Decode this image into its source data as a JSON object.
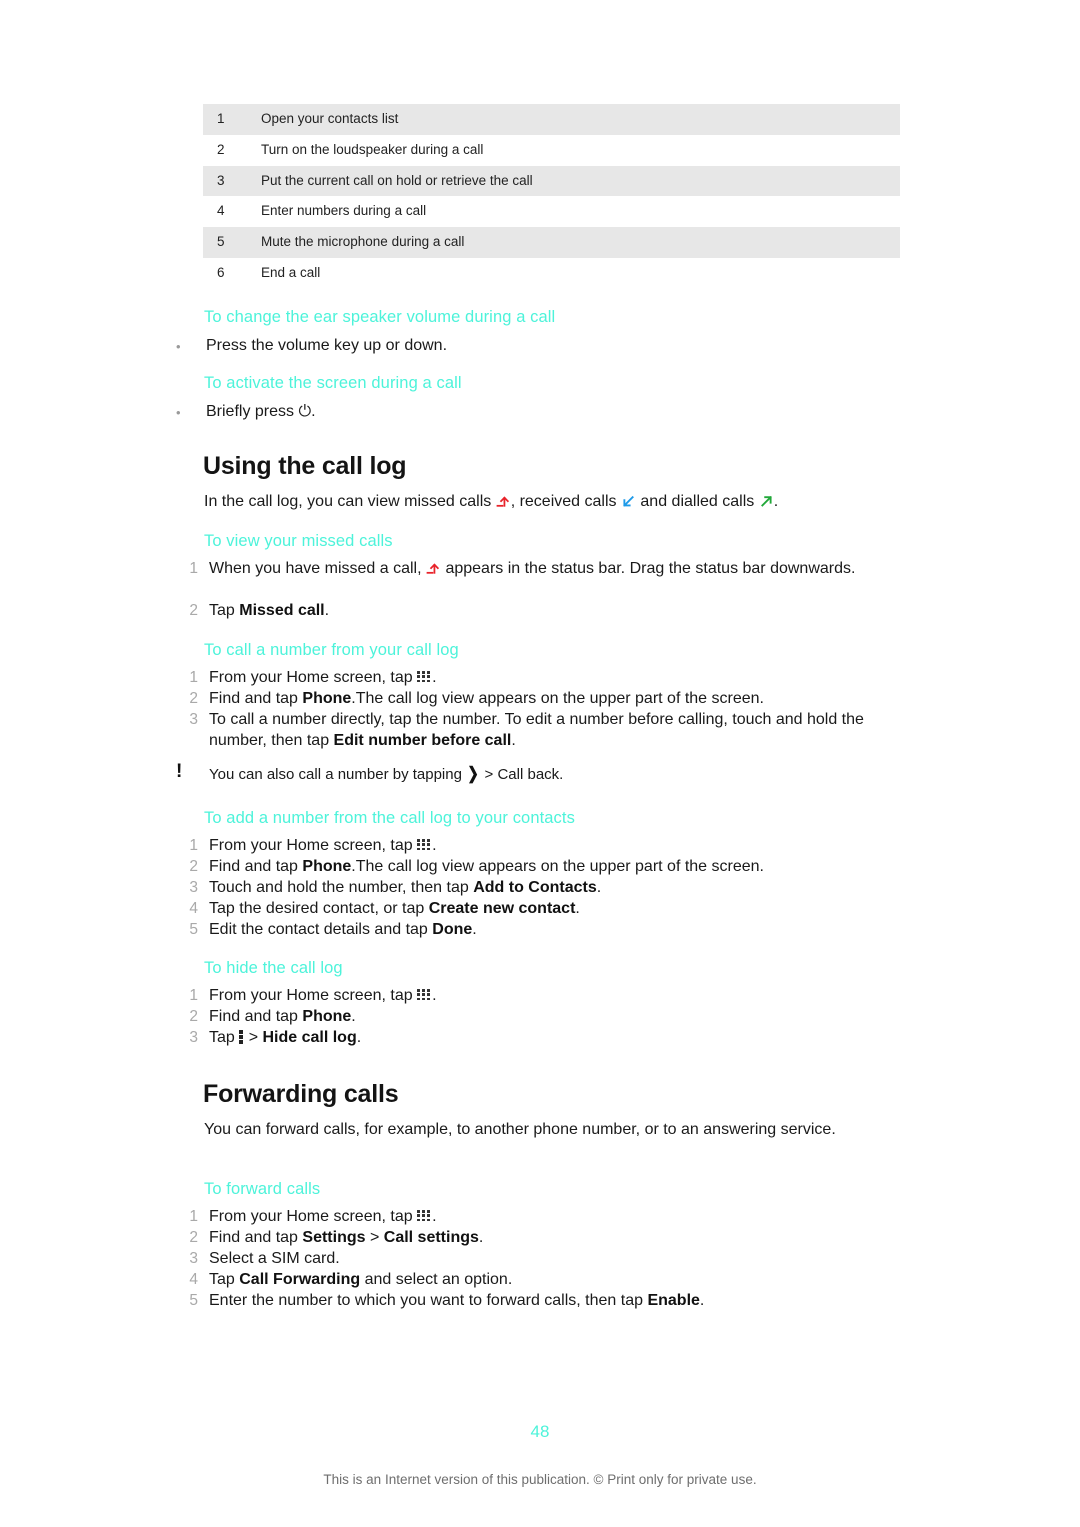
{
  "document": {
    "page_number": "48",
    "footer_note": "This is an Internet version of this publication. © Print only for private use.",
    "accent_color": "#4df3da",
    "missed_call_color": "#e8232a",
    "received_call_color": "#1e9ae8",
    "dialled_call_color": "#22a83a"
  },
  "legend_table": {
    "rows": [
      {
        "num": "1",
        "desc": "Open your contacts list"
      },
      {
        "num": "2",
        "desc": "Turn on the loudspeaker during a call"
      },
      {
        "num": "3",
        "desc": "Put the current call on hold or retrieve the call"
      },
      {
        "num": "4",
        "desc": "Enter numbers during a call"
      },
      {
        "num": "5",
        "desc": "Mute the microphone during a call"
      },
      {
        "num": "6",
        "desc": "End a call"
      }
    ]
  },
  "sections": {
    "ear_speaker": {
      "heading": "To change the ear speaker volume during a call",
      "bullet": "Press the volume key up or down."
    },
    "activate_screen": {
      "heading": "To activate the screen during a call",
      "bullet_prefix": "Briefly press ",
      "bullet_suffix": ".",
      "icon_name": "power-button-icon"
    },
    "using_call_log": {
      "title": "Using the call log",
      "intro_part1": "In the call log, you can view missed calls ",
      "intro_part2": ", received calls ",
      "intro_part3": " and dialled calls ",
      "intro_part4": "."
    },
    "view_missed": {
      "heading": "To view your missed calls",
      "step1_part1": "When you have missed a call, ",
      "step1_part2": " appears in the status bar. Drag the status bar downwards.",
      "step2_part1": "Tap ",
      "step2_bold": "Missed call",
      "step2_part2": "."
    },
    "call_number": {
      "heading": "To call a number from your call log",
      "step1_part1": "From your Home screen, tap ",
      "step1_part2": ".",
      "step2_part1": "Find and tap ",
      "step2_bold": "Phone",
      "step2_part2": ".The call log view appears on the upper part of the screen.",
      "step3_part1": "To call a number directly, tap the number. To edit a number before calling, touch and hold the number, then tap ",
      "step3_bold": "Edit number before call",
      "step3_part2": ".",
      "tip_part1": "You can also call a number by tapping ",
      "tip_part2": " > Call back."
    },
    "add_number": {
      "heading": "To add a number from the call log to your contacts",
      "step1_part1": "From your Home screen, tap ",
      "step1_part2": ".",
      "step2_part1": "Find and tap ",
      "step2_bold": "Phone",
      "step2_part2": ".The call log view appears on the upper part of the screen.",
      "step3_part1": "Touch and hold the number, then tap ",
      "step3_bold": "Add to Contacts",
      "step3_part2": ".",
      "step4_part1": "Tap the desired contact, or tap ",
      "step4_bold": "Create new contact",
      "step4_part2": ".",
      "step5_part1": "Edit the contact details and tap ",
      "step5_bold": "Done",
      "step5_part2": "."
    },
    "hide_call_log": {
      "heading": "To hide the call log",
      "step1_part1": "From your Home screen, tap ",
      "step1_part2": ".",
      "step2_part1": "Find and tap ",
      "step2_bold": "Phone",
      "step2_part2": ".",
      "step3_part1": "Tap ",
      "step3_part2": " > ",
      "step3_bold": "Hide call log",
      "step3_part3": "."
    },
    "forwarding_calls": {
      "title": "Forwarding calls",
      "intro": "You can forward calls, for example, to another phone number, or to an answering service."
    },
    "forward_calls": {
      "heading": "To forward calls",
      "step1_part1": "From your Home screen, tap ",
      "step1_part2": ".",
      "step2_part1": "Find and tap ",
      "step2_bold1": "Settings",
      "step2_mid": " > ",
      "step2_bold2": "Call settings",
      "step2_part2": ".",
      "step3": "Select a SIM card.",
      "step4_part1": "Tap ",
      "step4_bold": "Call Forwarding",
      "step4_part2": " and select an option.",
      "step5_part1": "Enter the number to which you want to forward calls, then tap ",
      "step5_bold": "Enable",
      "step5_part2": "."
    }
  }
}
